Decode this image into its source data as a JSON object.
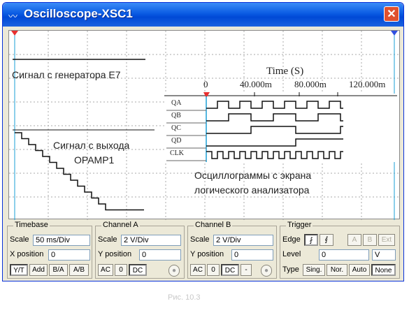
{
  "window": {
    "title": "Oscilloscope-XSC1",
    "close_label": "✕"
  },
  "screen": {
    "generator_label": "Сигнал с генератора E7",
    "opamp_label_1": "Сигнал с выхода",
    "opamp_label_2": "OPAMP1",
    "la_caption_1": "Осциллограммы с экрана",
    "la_caption_2": "логического анализатора",
    "time_axis_title": "Time (S)",
    "time_ticks": [
      "0",
      "40.000m",
      "80.000m",
      "120.000m"
    ],
    "channels": [
      "QA",
      "QB",
      "QC",
      "QD",
      "CLK"
    ]
  },
  "timebase": {
    "title": "Timebase",
    "scale_label": "Scale",
    "scale_value": "50 ms/Div",
    "xpos_label": "X position",
    "xpos_value": "0",
    "buttons": [
      "Y/T",
      "Add",
      "B/A",
      "A/B"
    ]
  },
  "channel_a": {
    "title": "Channel A",
    "scale_label": "Scale",
    "scale_value": "2  V/Div",
    "ypos_label": "Y position",
    "ypos_value": "0",
    "buttons": [
      "AC",
      "0",
      "DC"
    ]
  },
  "channel_b": {
    "title": "Channel B",
    "scale_label": "Scale",
    "scale_value": "2  V/Div",
    "ypos_label": "Y position",
    "ypos_value": "0",
    "buttons": [
      "AC",
      "0",
      "DC",
      "-"
    ]
  },
  "trigger": {
    "title": "Trigger",
    "edge_label": "Edge",
    "level_label": "Level",
    "level_value": "0",
    "level_unit": "V",
    "type_label": "Type",
    "edge_buttons": [
      "A",
      "B",
      "Ext"
    ],
    "type_buttons": [
      "Sing.",
      "Nor.",
      "Auto",
      "None"
    ]
  },
  "caption": "Рис. 10.3"
}
